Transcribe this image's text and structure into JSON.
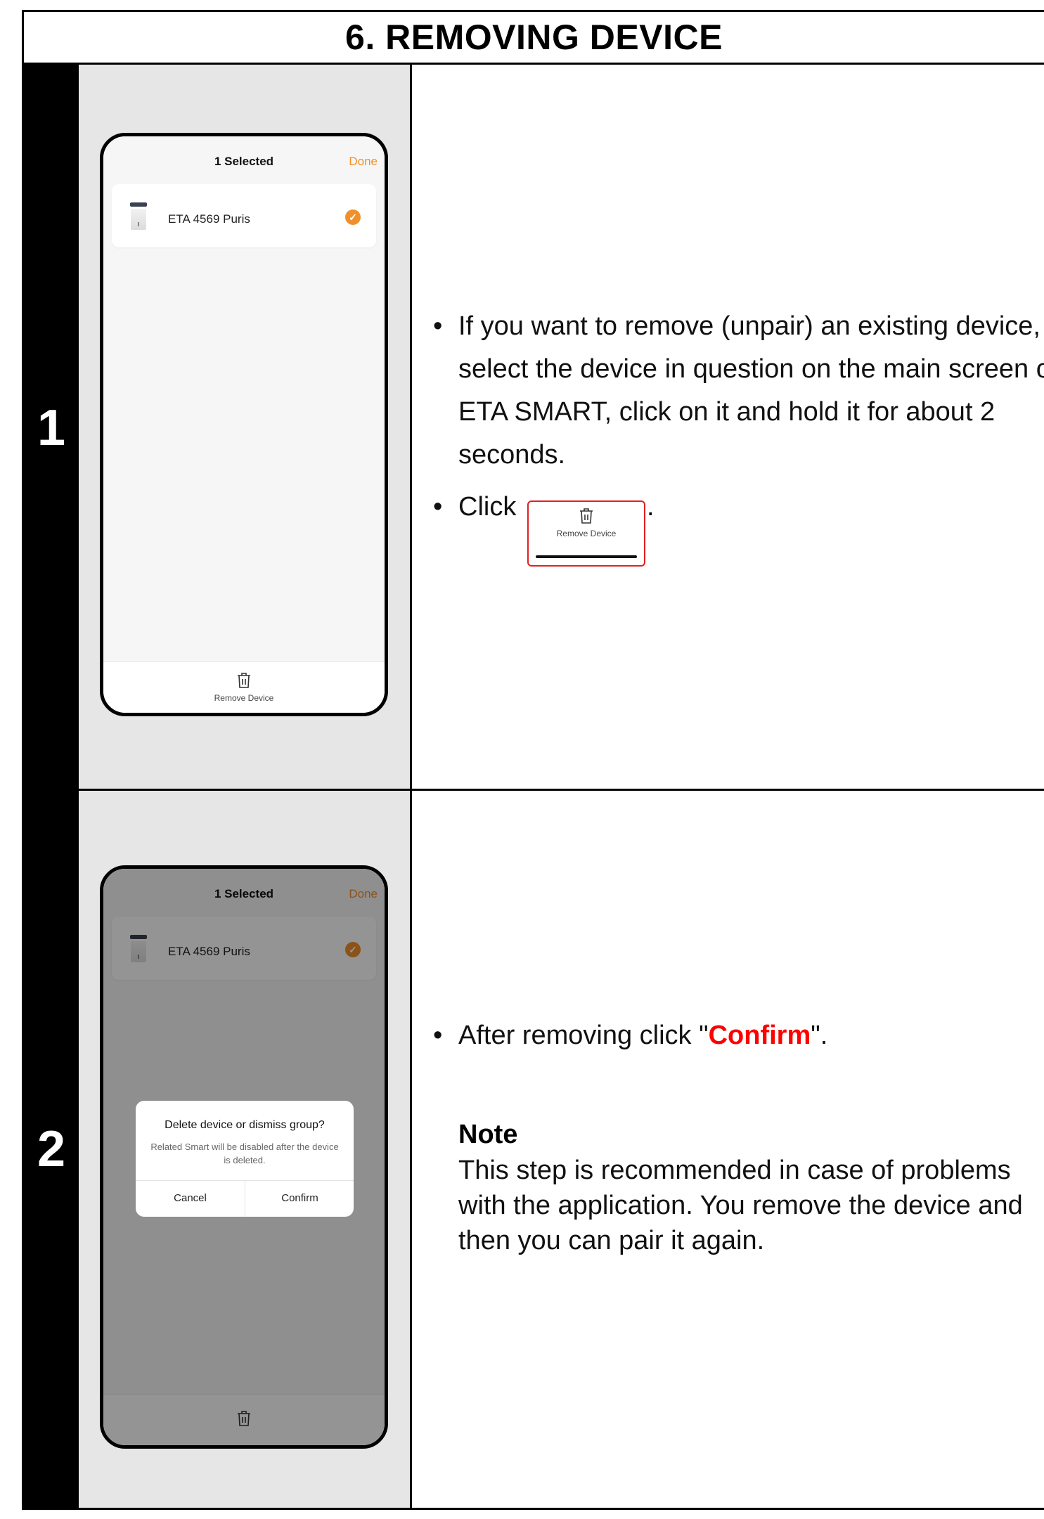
{
  "header": {
    "title": "6. REMOVING DEVICE"
  },
  "steps": [
    {
      "number": "1",
      "phone": {
        "title": "1 Selected",
        "done": "Done",
        "device_name": "ETA 4569 Puris",
        "footer_label": "Remove Device"
      },
      "bullets": [
        "If you want to remove (unpair) an existing device, select the device in question on the main screen of ETA SMART, click on it and hold it for about 2 seconds.",
        "Click"
      ],
      "inline_button_label": "Remove Device",
      "period": "."
    },
    {
      "number": "2",
      "phone": {
        "title": "1 Selected",
        "done": "Done",
        "device_name": "ETA 4569 Puris",
        "dialog": {
          "title": "Delete device or dismiss group?",
          "message": "Related Smart will be disabled after the device is deleted.",
          "cancel": "Cancel",
          "confirm": "Confirm"
        }
      },
      "bullet_prefix": "After removing click \"",
      "bullet_highlight": "Confirm",
      "bullet_suffix": "\".",
      "note_heading": "Note",
      "note_body": "This step is recommended in case of problems with the application. You remove the device and then you can pair it again."
    }
  ],
  "colors": {
    "accent_orange": "#f0902a",
    "highlight_red": "#ff0000"
  },
  "icons": [
    "trash-icon",
    "checkmark-icon",
    "air-purifier-icon"
  ]
}
